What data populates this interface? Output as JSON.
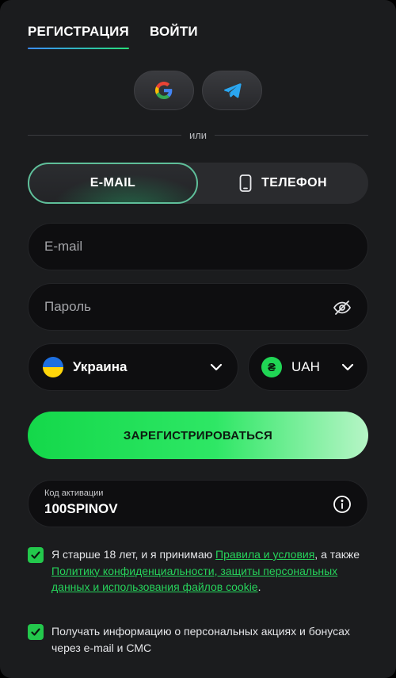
{
  "tabs": [
    {
      "label": "РЕГИСТРАЦИЯ",
      "active": true
    },
    {
      "label": "ВОЙТИ",
      "active": false
    }
  ],
  "social": {
    "google": "google-icon",
    "telegram": "telegram-icon"
  },
  "divider": {
    "text": "или"
  },
  "method_toggle": {
    "email_label": "E-MAIL",
    "phone_label": "ТЕЛЕФОН",
    "active": "email"
  },
  "form": {
    "email_placeholder": "E-mail",
    "password_placeholder": "Пароль",
    "country": "Украина",
    "currency": "UAH",
    "currency_symbol": "₴",
    "submit_label": "ЗАРЕГИСТРИРОВАТЬСЯ",
    "promo_label": "Код активации",
    "promo_value": "100SPINOV"
  },
  "consent": {
    "terms_pre": "Я старше 18 лет, и я принимаю ",
    "terms_link": "Правила и условия",
    "terms_mid": ", а также ",
    "privacy_link": "Политику конфиденциальности, защиты персональных данных и использования файлов cookie",
    "terms_end": ".",
    "marketing": "Получать информацию о персональных акциях и бонусах через e-mail и СМС"
  },
  "colors": {
    "accent_green": "#26d25b",
    "panel_bg": "#1b1c1e",
    "field_bg": "#0e0e10"
  }
}
